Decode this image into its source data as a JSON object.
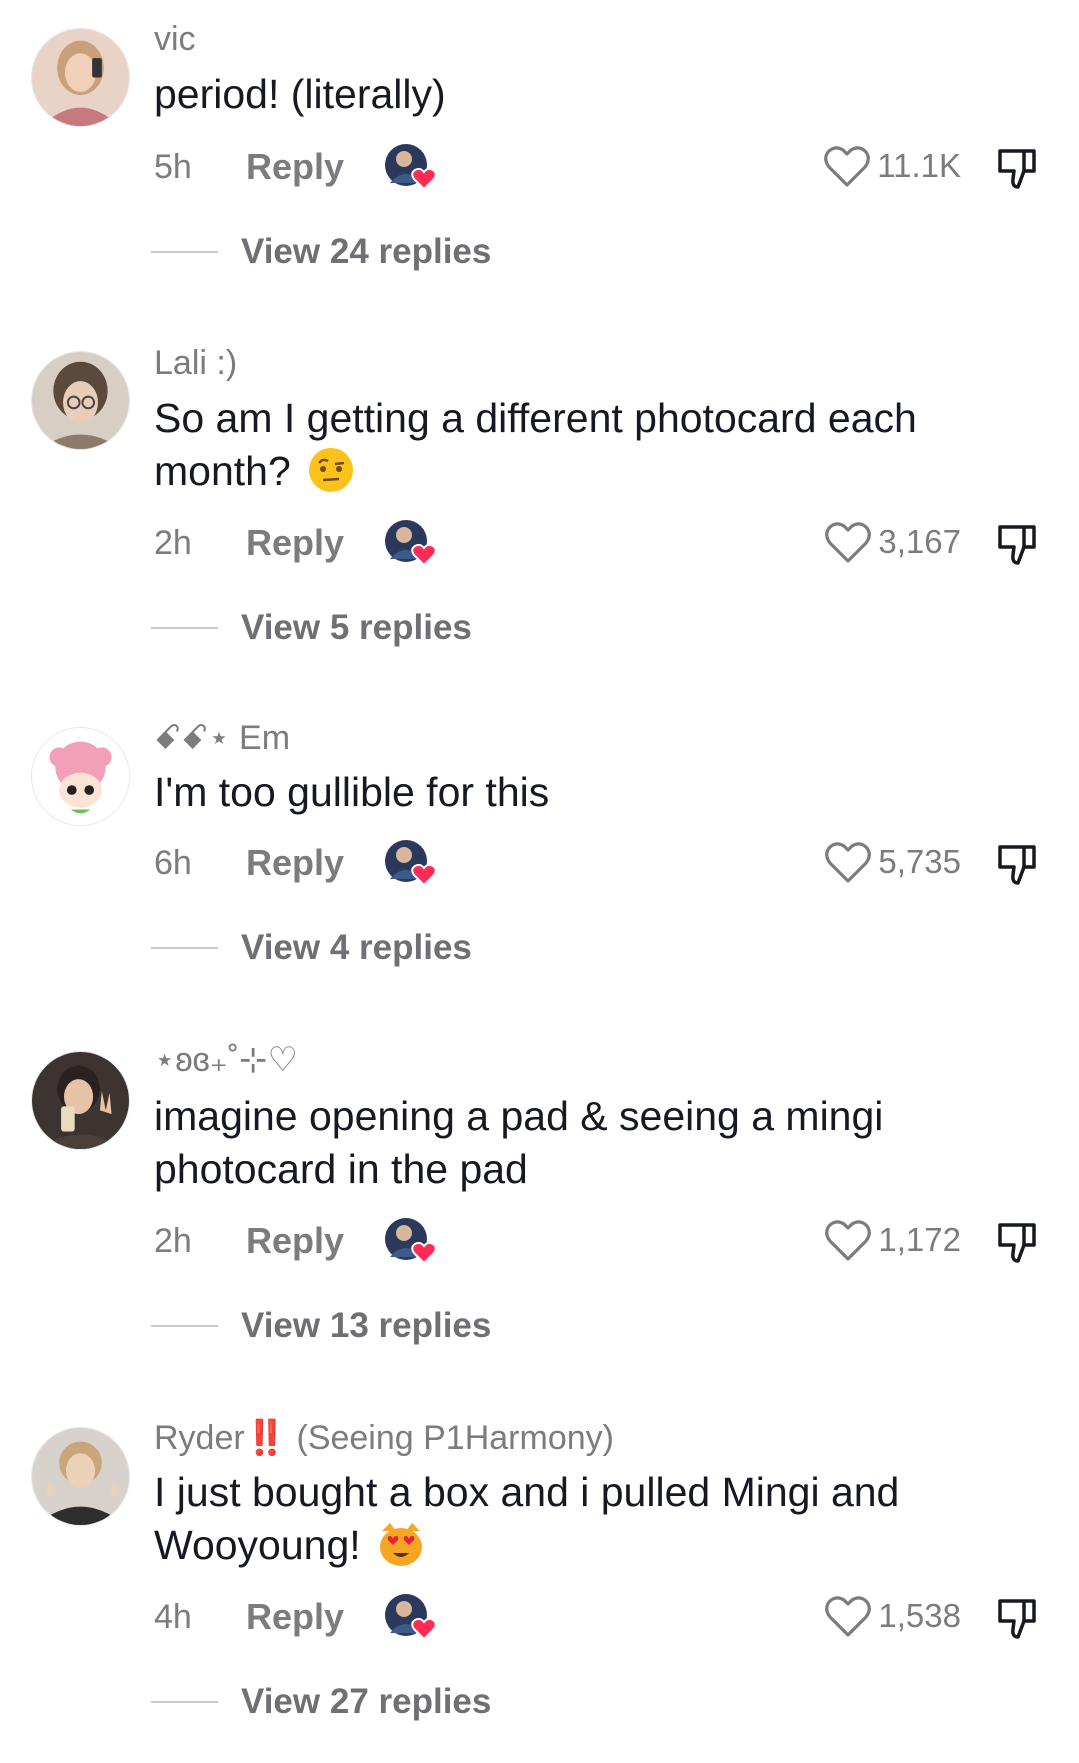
{
  "comments": [
    {
      "username": "vic",
      "text": "period! (literally)",
      "time": "5h",
      "reply_label": "Reply",
      "likes": "11.1K",
      "view_replies": "View 24 replies",
      "avatar_icon": "avatar-photo-icon",
      "avatar_color": "#c77a7e"
    },
    {
      "username": "Lali :)",
      "text": "So am I getting a different photocard each month?",
      "emoji": "raised-eyebrow-emoji",
      "time": "2h",
      "reply_label": "Reply",
      "likes": "3,167",
      "view_replies": "View 5 replies",
      "avatar_icon": "avatar-photo-icon",
      "avatar_color": "#8c7b6a"
    },
    {
      "username": "ꗃꗃ⋆ Em",
      "text": "I'm too gullible for this",
      "time": "6h",
      "reply_label": "Reply",
      "likes": "5,735",
      "view_replies": "View 4 replies",
      "avatar_icon": "avatar-doll-icon",
      "avatar_color": "#f2a0b8"
    },
    {
      "username": "⋆ʚ‌ɞ₊˚⊹♡",
      "text": "imagine opening a pad & seeing a mingi photocard in the pad",
      "time": "2h",
      "reply_label": "Reply",
      "likes": "1,172",
      "view_replies": "View 13 replies",
      "avatar_icon": "avatar-photo-icon",
      "avatar_color": "#4a3f3a"
    },
    {
      "username_prefix": "Ryder",
      "username_bang": "‼️",
      "username_suffix": " (Seeing P1Harmony)",
      "text": "I just bought a box and i pulled Mingi and Wooyoung!",
      "emoji": "heart-eyes-cat-emoji",
      "time": "4h",
      "reply_label": "Reply",
      "likes": "1,538",
      "view_replies": "View 27 replies",
      "avatar_icon": "avatar-photo-icon",
      "avatar_color": "#3a3a3a"
    }
  ],
  "colors": {
    "text_primary": "#161823",
    "text_secondary": "#7b7b80",
    "heart_red": "#fe2c55"
  }
}
